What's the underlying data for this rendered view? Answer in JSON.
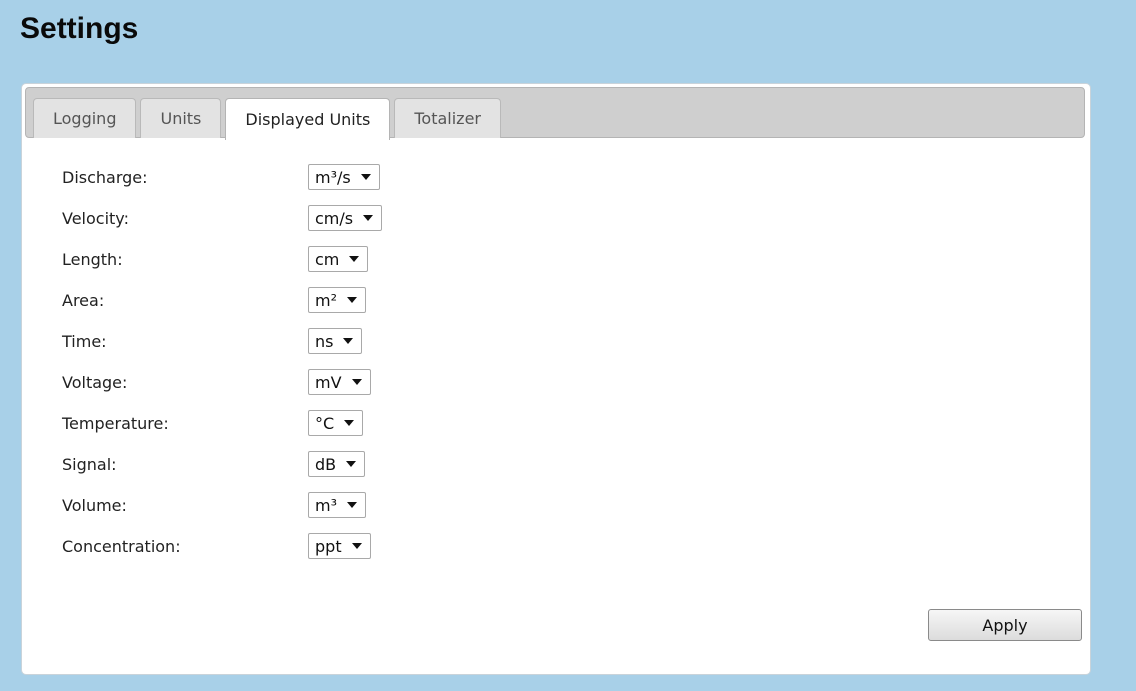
{
  "page": {
    "title": "Settings"
  },
  "tabs": [
    {
      "label": "Logging",
      "active": false
    },
    {
      "label": "Units",
      "active": false
    },
    {
      "label": "Displayed Units",
      "active": true
    },
    {
      "label": "Totalizer",
      "active": false
    }
  ],
  "fields": [
    {
      "label": "Discharge:",
      "value": "m³/s"
    },
    {
      "label": "Velocity:",
      "value": "cm/s"
    },
    {
      "label": "Length:",
      "value": "cm"
    },
    {
      "label": "Area:",
      "value": "m²"
    },
    {
      "label": "Time:",
      "value": "ns"
    },
    {
      "label": "Voltage:",
      "value": "mV"
    },
    {
      "label": "Temperature:",
      "value": "°C"
    },
    {
      "label": "Signal:",
      "value": "dB"
    },
    {
      "label": "Volume:",
      "value": "m³"
    },
    {
      "label": "Concentration:",
      "value": "ppt"
    }
  ],
  "actions": {
    "apply_label": "Apply"
  },
  "colors": {
    "background": "#a8d0e8",
    "panel": "#ffffff",
    "tabbar": "#cfcfcf"
  }
}
